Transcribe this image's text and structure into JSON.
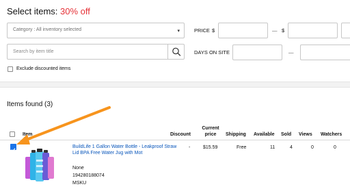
{
  "header": {
    "title_prefix": "Select items: ",
    "title_accent": "30% off",
    "accent_color": "#e53238"
  },
  "filters": {
    "category_value": "Category : All inventory selected",
    "price_label": "PRICE",
    "currency_symbol": "$",
    "range_dash": "—",
    "search_placeholder": "Search by item title",
    "days_label": "DAYS ON SITE",
    "exclude_label": "Exclude discounted items",
    "exclude_checked": false
  },
  "results": {
    "heading": "Items found (3)",
    "columns": {
      "item": "Item",
      "discount": "Discount",
      "current_price_1": "Current",
      "current_price_2": "price",
      "shipping": "Shipping",
      "available": "Available",
      "sold": "Sold",
      "views": "Views",
      "watchers": "Watchers"
    },
    "rows": [
      {
        "checked": true,
        "title": "BuildLife 1 Gallon Water Bottle - Leakproof Straw Lid BPA Free Water Jug with Mot",
        "condition": "None",
        "item_id": "194280188074",
        "sku_label": "MSKU",
        "discount": "-",
        "price": "$15.59",
        "shipping": "Free",
        "available": "11",
        "sold": "4",
        "views": "0",
        "watchers": "0"
      }
    ]
  },
  "annotation": {
    "arrow_color": "#f7941d"
  }
}
